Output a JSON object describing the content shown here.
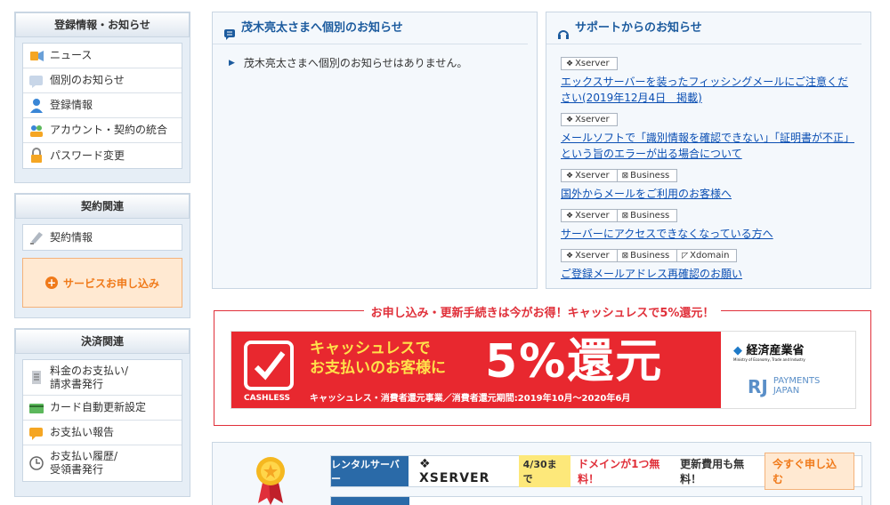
{
  "sidebar": {
    "registration": {
      "title": "登録情報・お知らせ",
      "items": [
        {
          "label": "ニュース",
          "icon": "news-icon"
        },
        {
          "label": "個別のお知らせ",
          "icon": "message-icon"
        },
        {
          "label": "登録情報",
          "icon": "user-icon"
        },
        {
          "label": "アカウント・契約の統合",
          "icon": "merge-icon"
        },
        {
          "label": "パスワード変更",
          "icon": "lock-icon"
        }
      ]
    },
    "contract": {
      "title": "契約関連",
      "items": [
        {
          "label": "契約情報",
          "icon": "contract-icon"
        }
      ],
      "apply_button": "サービスお申し込み"
    },
    "payment": {
      "title": "決済関連",
      "items": [
        {
          "label": "料金のお支払い/\n請求書発行",
          "icon": "invoice-icon"
        },
        {
          "label": "カード自動更新設定",
          "icon": "card-icon"
        },
        {
          "label": "お支払い報告",
          "icon": "report-icon"
        },
        {
          "label": "お支払い履歴/\n受領書発行",
          "icon": "history-icon"
        }
      ]
    }
  },
  "personal_notice": {
    "title": "茂木亮太さまへ個別のお知らせ",
    "message": "茂木亮太さまへ個別のお知らせはありません。"
  },
  "support": {
    "title": "サポートからのお知らせ",
    "items": [
      {
        "tags": [
          "Xserver"
        ],
        "link": "エックスサーバーを装ったフィッシングメールにご注意ください(2019年12月4日　掲載)"
      },
      {
        "tags": [
          "Xserver"
        ],
        "link": "メールソフトで「識別情報を確認できない」「証明書が不正」という旨のエラーが出る場合について"
      },
      {
        "tags": [
          "Xserver",
          "Business"
        ],
        "link": "国外からメールをご利用のお客様へ"
      },
      {
        "tags": [
          "Xserver",
          "Business"
        ],
        "link": "サーバーにアクセスできなくなっている方へ"
      },
      {
        "tags": [
          "Xserver",
          "Business",
          "Xdomain"
        ],
        "link": "ご登録メールアドレス再確認のお願い"
      }
    ]
  },
  "campaign": {
    "title": "お申し込み・更新手続きは今がお得！キャッシュレスで5%還元！",
    "banner": {
      "main": "キャッシュレスで\nお支払いのお客様に",
      "percent": "5%還元",
      "sub": "キャッシュレス・消費者還元事業／消費者還元期間:2019年10月～2020年6月",
      "logo_text": "CASHLESS",
      "meti": "経済産業省",
      "meti_sub": "Ministry of Economy, Trade and Industry",
      "payments": "PAYMENTS\nJAPAN"
    }
  },
  "promo": {
    "rows": [
      {
        "category": "レンタルサーバー",
        "brand": "XSERVER",
        "date": "4/30まで",
        "text": "ドメインが1つ無料！",
        "text2": "更新費用も無料！",
        "button": "今すぐ申し込む"
      }
    ]
  },
  "colors": {
    "accent_blue": "#1c5b9e",
    "link": "#0b4fb3",
    "campaign_red": "#e0303a",
    "orange": "#f07a1a"
  }
}
